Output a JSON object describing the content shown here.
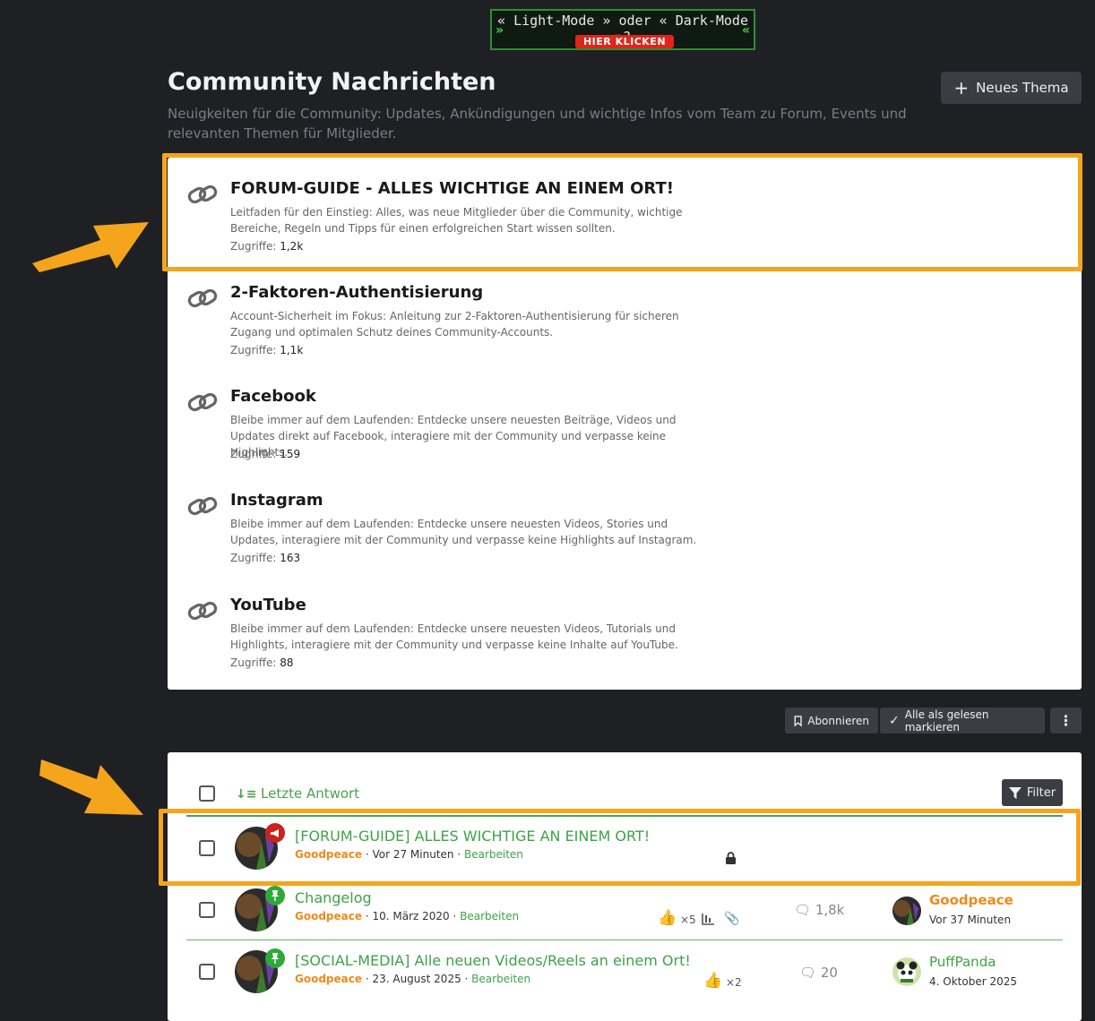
{
  "banner": {
    "line1": "« Light-Mode » oder « Dark-Mode »?",
    "line2": "HIER KLICKEN"
  },
  "header": {
    "title": "Community Nachrichten",
    "description": "Neuigkeiten für die Community: Updates, Ankündigungen und wichtige Infos vom Team zu Forum, Events und relevanten Themen für Mitglieder.",
    "new_topic_label": "Neues Thema"
  },
  "links": {
    "views_label": "Zugriffe:",
    "items": [
      {
        "title": "FORUM-GUIDE - ALLES WICHTIGE AN EINEM ORT!",
        "description": "Leitfaden für den Einstieg: Alles, was neue Mitglieder über die Community, wichtige Bereiche, Regeln und Tipps für einen erfolgreichen Start wissen sollten.",
        "views": "1,2k"
      },
      {
        "title": "2-Faktoren-Authentisierung",
        "description": "Account-Sicherheit im Fokus: Anleitung zur 2-Faktoren-Authentisierung für sicheren Zugang und optimalen Schutz deines Community-Accounts.",
        "views": "1,1k"
      },
      {
        "title": "Facebook",
        "description": "Bleibe immer auf dem Laufenden: Entdecke unsere neuesten Beiträge, Videos und Updates direkt auf Facebook, interagiere mit der Community und verpasse keine Highlights.",
        "views": "159"
      },
      {
        "title": "Instagram",
        "description": "Bleibe immer auf dem Laufenden: Entdecke unsere neuesten Videos, Stories und Updates, interagiere mit der Community und verpasse keine Highlights auf Instagram.",
        "views": "163"
      },
      {
        "title": "YouTube",
        "description": "Bleibe immer auf dem Laufenden: Entdecke unsere neuesten Videos, Tutorials und Highlights, interagiere mit der Community und verpasse keine Inhalte auf YouTube.",
        "views": "88"
      }
    ]
  },
  "actions": {
    "subscribe_label": "Abonnieren",
    "mark_read_label": "Alle als gelesen markieren"
  },
  "threads": {
    "sort_label": "Letzte Antwort",
    "filter_label": "Filter",
    "edit_label": "Bearbeiten",
    "items": [
      {
        "title": "[FORUM-GUIDE] ALLES WICHTIGE AN EINEM ORT!",
        "author": "Goodpeace",
        "date": "Vor 27 Minuten",
        "badge": "megaphone"
      },
      {
        "title": "Changelog",
        "author": "Goodpeace",
        "date": "10. März 2020",
        "likes": "×5",
        "replies": "1,8k",
        "last_user": "Goodpeace",
        "last_time": "Vor 37 Minuten",
        "badge": "pin"
      },
      {
        "title": "[SOCIAL-MEDIA] Alle neuen Videos/Reels an einem Ort!",
        "author": "Goodpeace",
        "date": "23. August 2025",
        "likes": "×2",
        "replies": "20",
        "last_user": "PuffPanda",
        "last_time": "4. Oktober 2025",
        "badge": "pin"
      }
    ]
  },
  "colors": {
    "accent_green": "#3ea249",
    "author_orange": "#ee8b1c",
    "highlight": "#f5a51c",
    "background": "#1f2024"
  }
}
